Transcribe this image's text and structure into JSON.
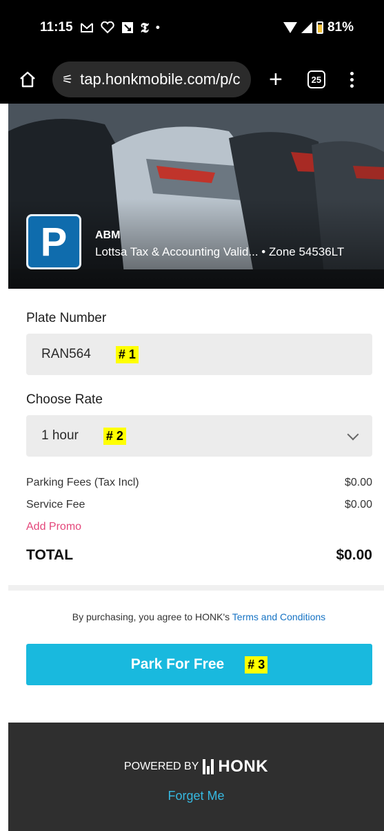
{
  "status_bar": {
    "time": "11:15",
    "battery": "81%",
    "battery_level": 0.81,
    "icons": [
      "gmail-icon",
      "heart-icon",
      "download-icon",
      "nytimes-icon",
      "dot-icon"
    ]
  },
  "browser": {
    "url": "tap.honkmobile.com/p/c",
    "tab_count": "25"
  },
  "hero": {
    "logo_letter": "P",
    "operator": "ABM",
    "lot_name": "Lottsa Tax & Accounting Valid...",
    "zone": " • Zone 54536LT"
  },
  "form": {
    "plate_label": "Plate Number",
    "plate_value": "RAN564",
    "plate_annotation": "# 1",
    "rate_label": "Choose Rate",
    "rate_value": "1 hour",
    "rate_annotation": "# 2"
  },
  "fees": {
    "parking_label": "Parking Fees (Tax Incl)",
    "parking_value": "$0.00",
    "service_label": "Service Fee",
    "service_value": "$0.00",
    "promo_label": "Add Promo",
    "total_label": "TOTAL",
    "total_value": "$0.00"
  },
  "terms": {
    "prefix": "By purchasing, you agree to HONK's ",
    "link": "Terms and Conditions"
  },
  "cta": {
    "label": "Park For Free",
    "annotation": "# 3"
  },
  "footer": {
    "powered_by": "POWERED BY",
    "brand": "HONK",
    "forget_me": "Forget Me"
  },
  "colors": {
    "cta": "#19b9de",
    "promo": "#e4467a",
    "link": "#1673c4",
    "footer_bg": "#2f2f2f",
    "annotation": "#ffff00"
  }
}
